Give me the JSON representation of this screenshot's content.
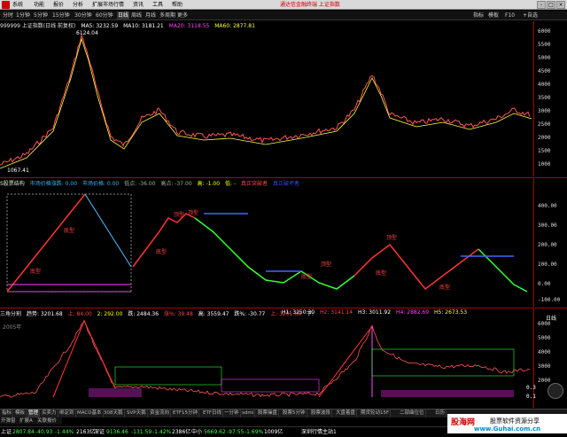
{
  "menubar": {
    "items": [
      "系统",
      "功能",
      "报价",
      "分析",
      "扩展市场行情",
      "资讯",
      "工具",
      "帮助"
    ],
    "center_title": "通达信金融终端 上证指数",
    "window_buttons": [
      "-",
      "□",
      "×"
    ]
  },
  "periodbar": {
    "periods": [
      "分时",
      "1分钟",
      "5分钟",
      "15分钟",
      "30分钟",
      "60分钟",
      "日线",
      "周线",
      "月线",
      "多周期",
      "更多"
    ],
    "active": "日线",
    "right_tools": [
      "指标",
      "模板",
      "F10",
      "+自选"
    ]
  },
  "main_panel": {
    "legend": [
      {
        "text": "999999 上证指数(日线 前复权)",
        "color": "#e0e0e0"
      },
      {
        "text": "MA5: 3232.59",
        "color": "#ffffff"
      },
      {
        "text": "MA10: 3181.21",
        "color": "#ffffff"
      },
      {
        "text": "MA20: 3118.55",
        "color": "#ff44ff"
      },
      {
        "text": "MA60: 2877.81",
        "color": "#ffff44"
      }
    ],
    "high_label": "6124.04",
    "low_label": "1067.41",
    "axis_ticks": [
      "6000",
      "5500",
      "5000",
      "4500",
      "4000",
      "3500",
      "3000",
      "2500",
      "2000",
      "1500",
      "1000"
    ]
  },
  "panel2": {
    "legend": [
      {
        "text": "S股票结构",
        "color": "#e0e0e0"
      },
      {
        "text": "市场价格涨跌: 0.00",
        "color": "#44aaff"
      },
      {
        "text": "市场价格: 0.00",
        "color": "#44aaff"
      },
      {
        "text": "低点: -36.00",
        "color": "#aaaaaa"
      },
      {
        "text": "高点: -37.00",
        "color": "#aaaaaa"
      },
      {
        "text": "高: -1.00",
        "color": "#ffff00"
      },
      {
        "text": "低: -",
        "color": "#ffff00"
      },
      {
        "text": "真正突破者",
        "color": "#ff4444"
      },
      {
        "text": "真正破坏者",
        "color": "#4444ff"
      }
    ],
    "labels": [
      "底型",
      "底型",
      "顶型",
      "底型",
      "顶型",
      "底型",
      "底型",
      "顶型",
      "顶型",
      "底型"
    ],
    "axis_ticks": [
      "400.00",
      "300.00",
      "200.00",
      "100.00",
      "0.00",
      "-100.00"
    ]
  },
  "panel3": {
    "legend": [
      {
        "text": "三角分割",
        "color": "#e0e0e0"
      },
      {
        "text": "趋势: 3201.68",
        "color": "#ffffff"
      },
      {
        "text": "上: 84.00",
        "color": "#ff4444"
      },
      {
        "text": "2: 292.00",
        "color": "#ffff00"
      },
      {
        "text": "跌: 2484.36",
        "color": "#ffffff"
      },
      {
        "text": "涨%: 39.48",
        "color": "#ff4444"
      },
      {
        "text": "高: 3559.47",
        "color": "#ffffff"
      },
      {
        "text": "跌%: -30.77",
        "color": "#ffffff"
      },
      {
        "text": "上: 3201.68",
        "color": "#ff4444"
      },
      {
        "text": "下:",
        "color": "#ffffff"
      }
    ],
    "legend2": [
      {
        "text": "H1: 3250.30",
        "color": "#ffffff"
      },
      {
        "text": "H2: 3141.14",
        "color": "#ff4444"
      },
      {
        "text": "H3: 3011.92",
        "color": "#ffffff"
      },
      {
        "text": "H4: 2882.69",
        "color": "#ff44ff"
      },
      {
        "text": "H5: 2673.53",
        "color": "#ffff44"
      }
    ],
    "axis_ticks": [
      "6000",
      "5000",
      "4000",
      "3000",
      "2000"
    ],
    "right_labels": [
      "日线",
      "0.3",
      "0.1"
    ],
    "bottom_left": "2005年"
  },
  "tabbar": {
    "tabs": [
      "指标",
      "模板",
      "管理",
      "买卖力",
      "绑定到",
      "MACD基本",
      "308天鹅",
      "SVP天鹅",
      "资金流向",
      "ETF15分钟",
      "ETF日线",
      "一分钟",
      "sdmi",
      "股票操盘",
      "股票5分钟",
      "股票波段",
      "大盘着盘",
      "期货轮动15F",
      "二部曲位位",
      "日历"
    ],
    "active": "管理"
  },
  "tabbar2": {
    "tabs": [
      "开弹窗",
      "扩展A",
      "关联报价"
    ]
  },
  "statusbar": [
    {
      "text": "上证",
      "color": "#ffffff"
    },
    {
      "text": "2807.84",
      "color": "#44ff44"
    },
    {
      "text": "-40.93",
      "color": "#44ff44"
    },
    {
      "text": "-1.44%",
      "color": "#44ff44"
    },
    {
      "text": "2163亿",
      "color": "#ffffff"
    },
    {
      "text": "深证",
      "color": "#ffffff"
    },
    {
      "text": "9136.46",
      "color": "#44ff44"
    },
    {
      "text": "-131.59",
      "color": "#44ff44"
    },
    {
      "text": "-1.42%",
      "color": "#44ff44"
    },
    {
      "text": "2386亿",
      "color": "#ffffff"
    },
    {
      "text": "中小",
      "color": "#ffffff"
    },
    {
      "text": "5669.62",
      "color": "#44ff44"
    },
    {
      "text": "-97.55",
      "color": "#44ff44"
    },
    {
      "text": "-1.69%",
      "color": "#44ff44"
    },
    {
      "text": "1009亿",
      "color": "#ffffff"
    },
    {
      "text": "深圳行情主站1",
      "color": "#ffffff"
    }
  ],
  "watermark": {
    "logo": "股海网",
    "tagline": "股票软件资源分享",
    "url": "www.Guhai.com.cn"
  },
  "colors": {
    "up": "#ff3333",
    "down": "#33ff33",
    "panel_border": "#aa0000"
  }
}
